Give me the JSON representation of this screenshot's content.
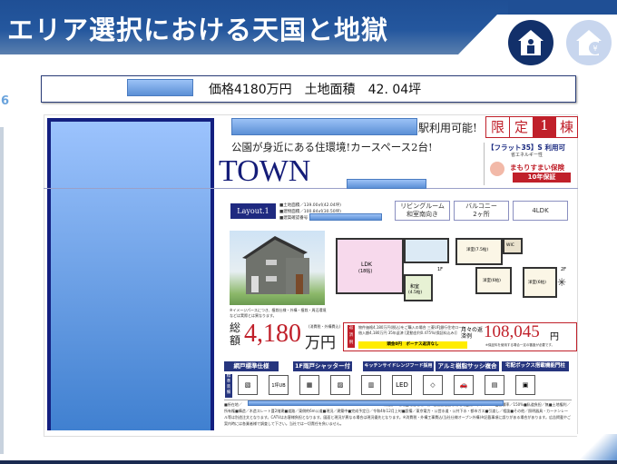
{
  "header": {
    "title": "エリア選択における天国と地獄",
    "icons": [
      "house-person-icon",
      "house-yen-icon"
    ]
  },
  "price_bar": {
    "text": "価格4180万円　土地面積　42. 04坪"
  },
  "page_number": "6",
  "flyer": {
    "station_suffix": "駅利用可能!",
    "limited": [
      "限",
      "定",
      "1",
      "棟"
    ],
    "catch": "公園が身近にある住環境!カースペース2台!",
    "town": "TOWN",
    "flat35": "【フラット35】S 利用可",
    "flat35_sub": "省エネルギー性",
    "insurance": "まもりすまい保険",
    "insurance_badge": "10年保証",
    "layout_label": "Layout.1",
    "specs": [
      "■土地面積／139.00㎡(42.04坪)",
      "■建物面積／100.84㎡(30.50坪)",
      "■建築確認番号"
    ],
    "features": [
      {
        "l1": "リビングルーム",
        "l2": "和室南向き"
      },
      {
        "l1": "バルコニー",
        "l2": "2ヶ所"
      },
      {
        "l1": "4LDK",
        "l2": ""
      }
    ],
    "image_note": "※イメージパースにつき、植栽仕様・外構・植栽・周辺環境などは実際とは異なります。",
    "floor1": {
      "ldk": "LDK",
      "ldk_size": "(18帖)",
      "washitsu": "和室",
      "washitsu_size": "(4.5帖)",
      "label": "1F"
    },
    "floor2": {
      "rooms": [
        "洋室(7.5帖)",
        "洋室(6帖)",
        "洋室(6帖)"
      ],
      "label": "2F",
      "balcony": "バルコニー",
      "wic": "WIC"
    },
    "total_label": "総額",
    "total_price": "4,180",
    "total_unit": "万円",
    "total_note": "(消費税・外構費込)",
    "loan_tag": "返済例",
    "loan_text": "物件価格4,180万円(税込)をご購入の場合 三菱UFJ銀行住宅ローン 借入額4,180万円 35年返済 [変動金利0.475%(保証料込み)]",
    "loan_highlight": "頭金0円　ボーナス返済なし",
    "monthly_label": "月々の返済例",
    "monthly_price": "108,045",
    "monthly_unit": "円",
    "monthly_note": "※保証料を使用する場合一定の審査が必要です。",
    "equipment_tabs": [
      "網戸標準仕様",
      "1F雨戸シャッター付",
      "キッチンサイドレンジフード採用",
      "アルミ樹脂サッシ複合窓",
      "宅配ボックス搭載機能門柱"
    ],
    "equipment_side": "標準装備",
    "equipment_icons": [
      "1坪UB",
      "LED"
    ],
    "footer_lines": [
      "■所在地／　　　　　　　　　　　　　　　　　　　　　　　　　　　　　　　　　　　　　　　線徒歩／宅地■用途地域／第1種低層住居専用地域■建ぺい率／60%■容積率／150%■私道負担／無■土地権利／所有権■構造／木造スレート葺2階建■道路／東側約6m公道■現況／建築中■完成予定日／令和4年",
      "12月上旬■設備／東京電力・公営水道・公共下水・都市ガス■引渡し／相談■その他／照明器具・カーテンレール等は別途注文となります。CATVはお客様負担となります。図面と現況が異なる場合は現況優先となります。※消費税・外構工事費込(当社仕様オープン外構)※記載事項に誤りがある場合があります。広告掲載やご案内時には各業者様で調査して下さい。当社では一切責任を負いません。"
    ],
    "colors": {
      "navy": "#1a2a80",
      "red": "#c0202a",
      "header_blue": "#1f4f95",
      "placeholder_blue": "#6fa0e8"
    }
  }
}
